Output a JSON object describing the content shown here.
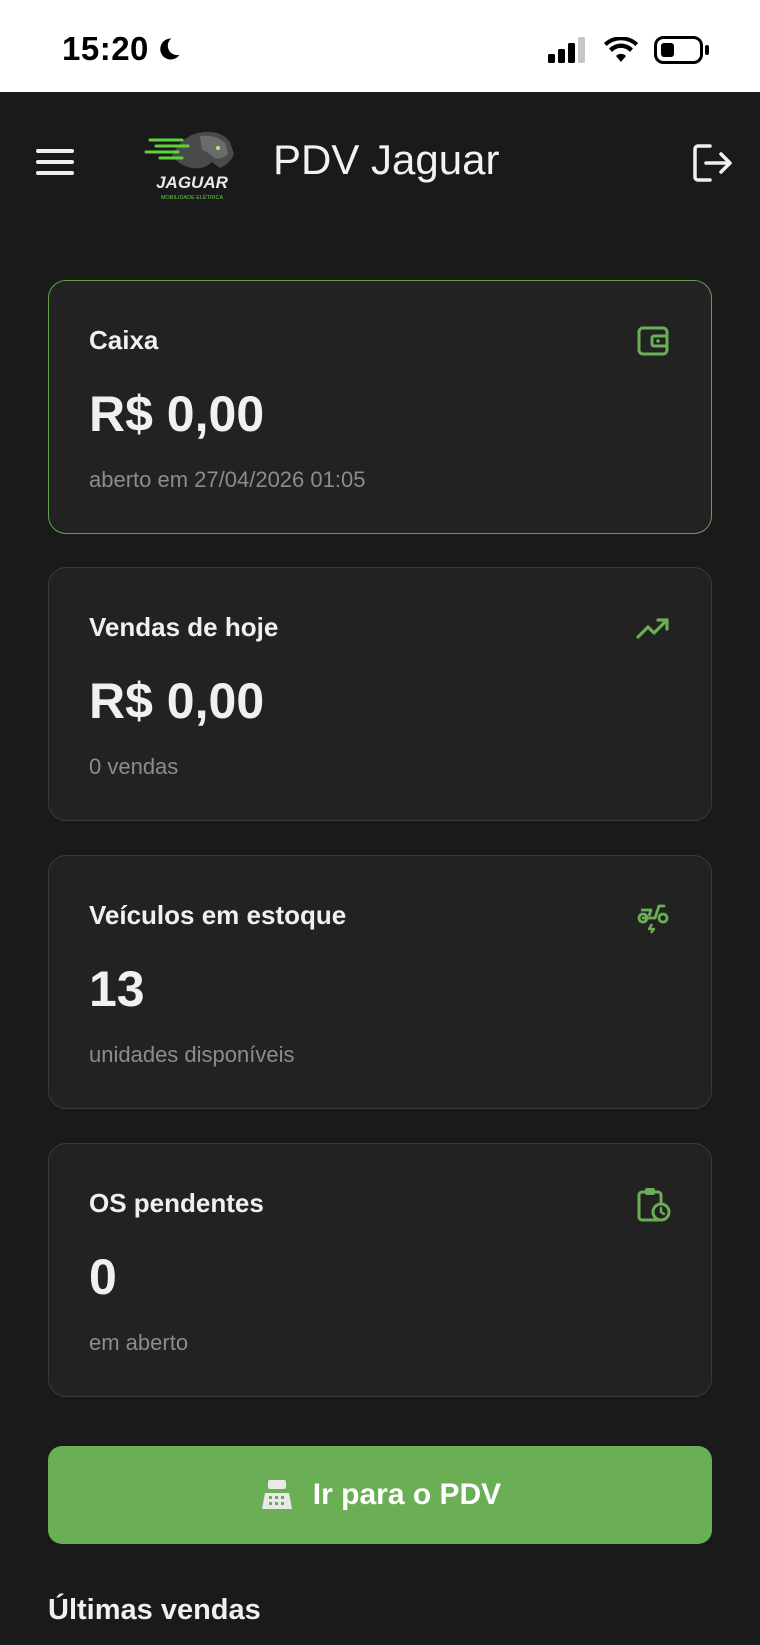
{
  "status_bar": {
    "time": "15:20"
  },
  "header": {
    "title": "PDV Jaguar",
    "logo_text": "JAGUAR",
    "logo_subtext": "MOBILIDADE ELÉTRICA"
  },
  "cards": [
    {
      "title": "Caixa",
      "value": "R$ 0,00",
      "subtitle": "aberto em 27/04/2026 01:05",
      "icon": "wallet-icon"
    },
    {
      "title": "Vendas de hoje",
      "value": "R$ 0,00",
      "subtitle": "0 vendas",
      "icon": "trending-up-icon"
    },
    {
      "title": "Veículos em estoque",
      "value": "13",
      "subtitle": "unidades disponíveis",
      "icon": "electric-scooter-icon"
    },
    {
      "title": "OS pendentes",
      "value": "0",
      "subtitle": "em aberto",
      "icon": "clipboard-clock-icon"
    }
  ],
  "cta": {
    "label": "Ir para o PDV",
    "icon": "cash-register-icon"
  },
  "recent_sales": {
    "title": "Últimas vendas"
  },
  "colors": {
    "accent": "#6aae56",
    "background": "#1a1a1a",
    "card": "#222222"
  }
}
